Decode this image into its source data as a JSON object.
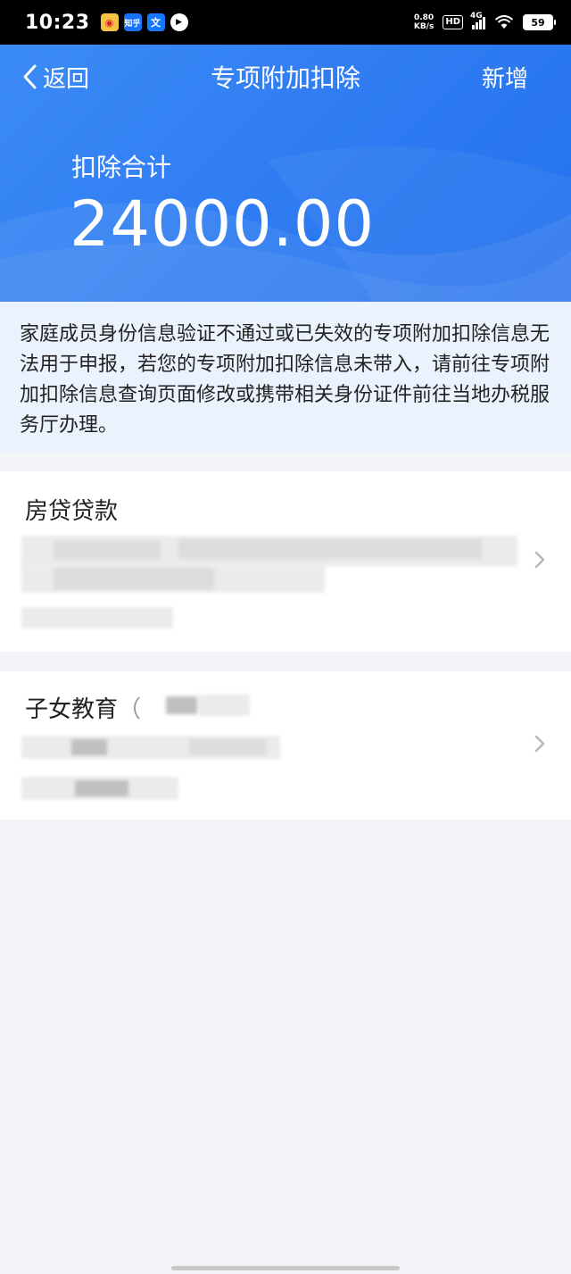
{
  "status_bar": {
    "time": "10:23",
    "app_icons": [
      "weibo-icon",
      "zhihu-icon",
      "wen-icon",
      "play-icon"
    ],
    "zhihu_text": "知乎",
    "wen_text": "文",
    "net_speed_value": "0.80",
    "net_speed_unit": "KB/s",
    "hd": "HD",
    "network": "4G",
    "battery": "59"
  },
  "nav": {
    "back_label": "返回",
    "title": "专项附加扣除",
    "add_label": "新增"
  },
  "summary": {
    "label": "扣除合计",
    "total": "24000.00"
  },
  "notice": {
    "text": "家庭成员身份信息验证不通过或已失效的专项附加扣除信息无法用于申报，若您的专项附加扣除信息未带入，请前往专项附加扣除信息查询页面修改或携带相关身份证件前往当地办税服务厅办理。"
  },
  "items": [
    {
      "title": "房贷贷款",
      "title_suffix": ""
    },
    {
      "title": "子女教育",
      "title_suffix": "（"
    }
  ],
  "colors": {
    "header_blue": "#2f7cf2",
    "notice_bg": "#eaf2fd",
    "page_bg": "#f2f4f8"
  }
}
